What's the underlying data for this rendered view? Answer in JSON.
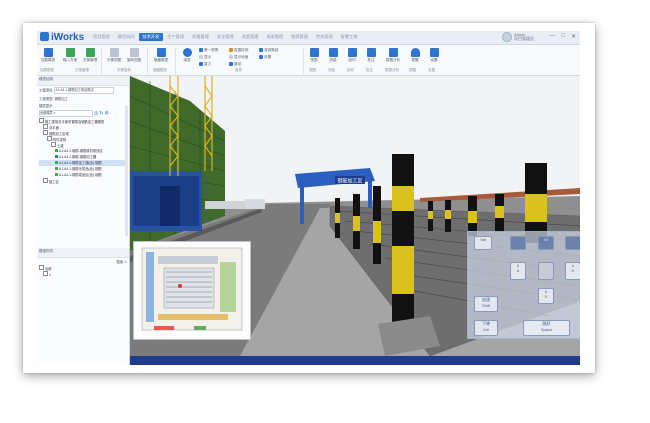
{
  "app": {
    "title": "iWorks"
  },
  "tabs": [
    "项目管理",
    "模型协同",
    "技术开发",
    "生产管理",
    "质量管理",
    "安全管理",
    "进度管理",
    "成本管理",
    "物资管理",
    "劳务管理",
    "智慧工地"
  ],
  "active_tab_index": 2,
  "user": {
    "name": "Admin",
    "role": "项目管理员"
  },
  "window_controls": [
    "—",
    "□",
    "✕"
  ],
  "ribbon": {
    "buttons": [
      {
        "label": "加载模型",
        "icon": "load-model-icon",
        "color": "#2f74d0"
      },
      {
        "label": "输入方案",
        "icon": "input-plan-icon",
        "color": "#3aa65c"
      },
      {
        "label": "方案管理",
        "icon": "plan-manage-icon",
        "color": "#3aa65c"
      },
      {
        "label": "平移视图",
        "icon": "pan-view-icon",
        "color": "#b9c3d1"
      },
      {
        "label": "旋转视图",
        "icon": "rotate-view-icon",
        "color": "#b9c3d1"
      },
      {
        "label": "隐藏模型",
        "icon": "hide-model-icon",
        "color": "#2f74d0"
      },
      {
        "label": "漫游",
        "icon": "walk-icon",
        "color": "#2f74d0"
      }
    ],
    "small_items": [
      "第一视角",
      "显示",
      "重力",
      "碰撞检测",
      "显示地面",
      "路径",
      "漫游路线",
      "设置"
    ],
    "right_buttons": [
      {
        "label": "视图",
        "icon": "view-icon"
      },
      {
        "label": "测量",
        "icon": "measure-icon"
      },
      {
        "label": "剖切",
        "icon": "section-icon"
      },
      {
        "label": "批注",
        "icon": "annotate-icon"
      },
      {
        "label": "数据分析",
        "icon": "analysis-icon"
      },
      {
        "label": "提醒",
        "icon": "alert-icon"
      },
      {
        "label": "设置",
        "icon": "settings-icon"
      }
    ],
    "groups": [
      "加载模型",
      "方案管理",
      "平移旋转",
      "隐藏模型",
      "漫游",
      "视图",
      "测量",
      "剖切",
      "批注",
      "数据分析",
      "提醒",
      "设置"
    ]
  },
  "left_panel": {
    "title": "模型结构",
    "project_label": "工程项目:",
    "project_value": "A1-A4.1-钢筋加工场及周边",
    "type_label": "工程类型:",
    "type_value": "钢筋加工",
    "filter_label": "楼层显示:",
    "filter_value": "全部楼层",
    "tree": [
      {
        "label": "施工现场总平面布置图及钢筋加工棚模型",
        "level": 0,
        "kind": "box"
      },
      {
        "label": "总平面",
        "level": 1,
        "kind": "box"
      },
      {
        "label": "钢筋加工区域",
        "level": 1,
        "kind": "box"
      },
      {
        "label": "构件类别",
        "level": 2,
        "kind": "box"
      },
      {
        "label": "土建",
        "level": 3,
        "kind": "box"
      },
      {
        "label": "A1-A4.1-钢筋-钢筋原材堆放区",
        "level": 4,
        "kind": "green"
      },
      {
        "label": "A1-A4.1-钢筋-钢筋加工棚",
        "level": 4,
        "kind": "blue"
      },
      {
        "label": "A1-A4.1-钢筋加工棚(含)-钢筋",
        "level": 4,
        "kind": "green",
        "selected": true
      },
      {
        "label": "A1-A4.1-钢筋半成品(含)-钢筋",
        "level": 4,
        "kind": "green"
      },
      {
        "label": "A1-A4.1-钢筋成品区(含)-钢筋",
        "level": 4,
        "kind": "green"
      },
      {
        "label": "施工区",
        "level": 1,
        "kind": "box"
      }
    ],
    "lower_title": "模型构件",
    "lower_header_right": "搜索",
    "lower_tree": [
      "全部",
      "1"
    ]
  },
  "scene": {
    "sign_text": "钢筋加工区"
  },
  "controls": {
    "keys": [
      {
        "id": "tab",
        "top": "Tab",
        "bottom": ""
      },
      {
        "id": "q",
        "top": "",
        "bottom": ""
      },
      {
        "id": "w",
        "top": "W",
        "bottom": ""
      },
      {
        "id": "e",
        "top": "",
        "bottom": ""
      },
      {
        "id": "a",
        "top": "",
        "bottom": "A"
      },
      {
        "id": "s",
        "top": "",
        "bottom": ""
      },
      {
        "id": "d",
        "top": "",
        "bottom": "D"
      },
      {
        "id": "shift",
        "top": "加速",
        "bottom": "Shift"
      },
      {
        "id": "x",
        "top": "",
        "bottom": "X"
      },
      {
        "id": "ctrl",
        "top": "下降",
        "bottom": "Ctrl"
      },
      {
        "id": "space",
        "top": "跳跃",
        "bottom": "Space"
      }
    ]
  },
  "colors": {
    "accent": "#2f74d0",
    "status": "#223a8c",
    "sky": "#eef0f2",
    "ground": "#9a9a9a"
  }
}
